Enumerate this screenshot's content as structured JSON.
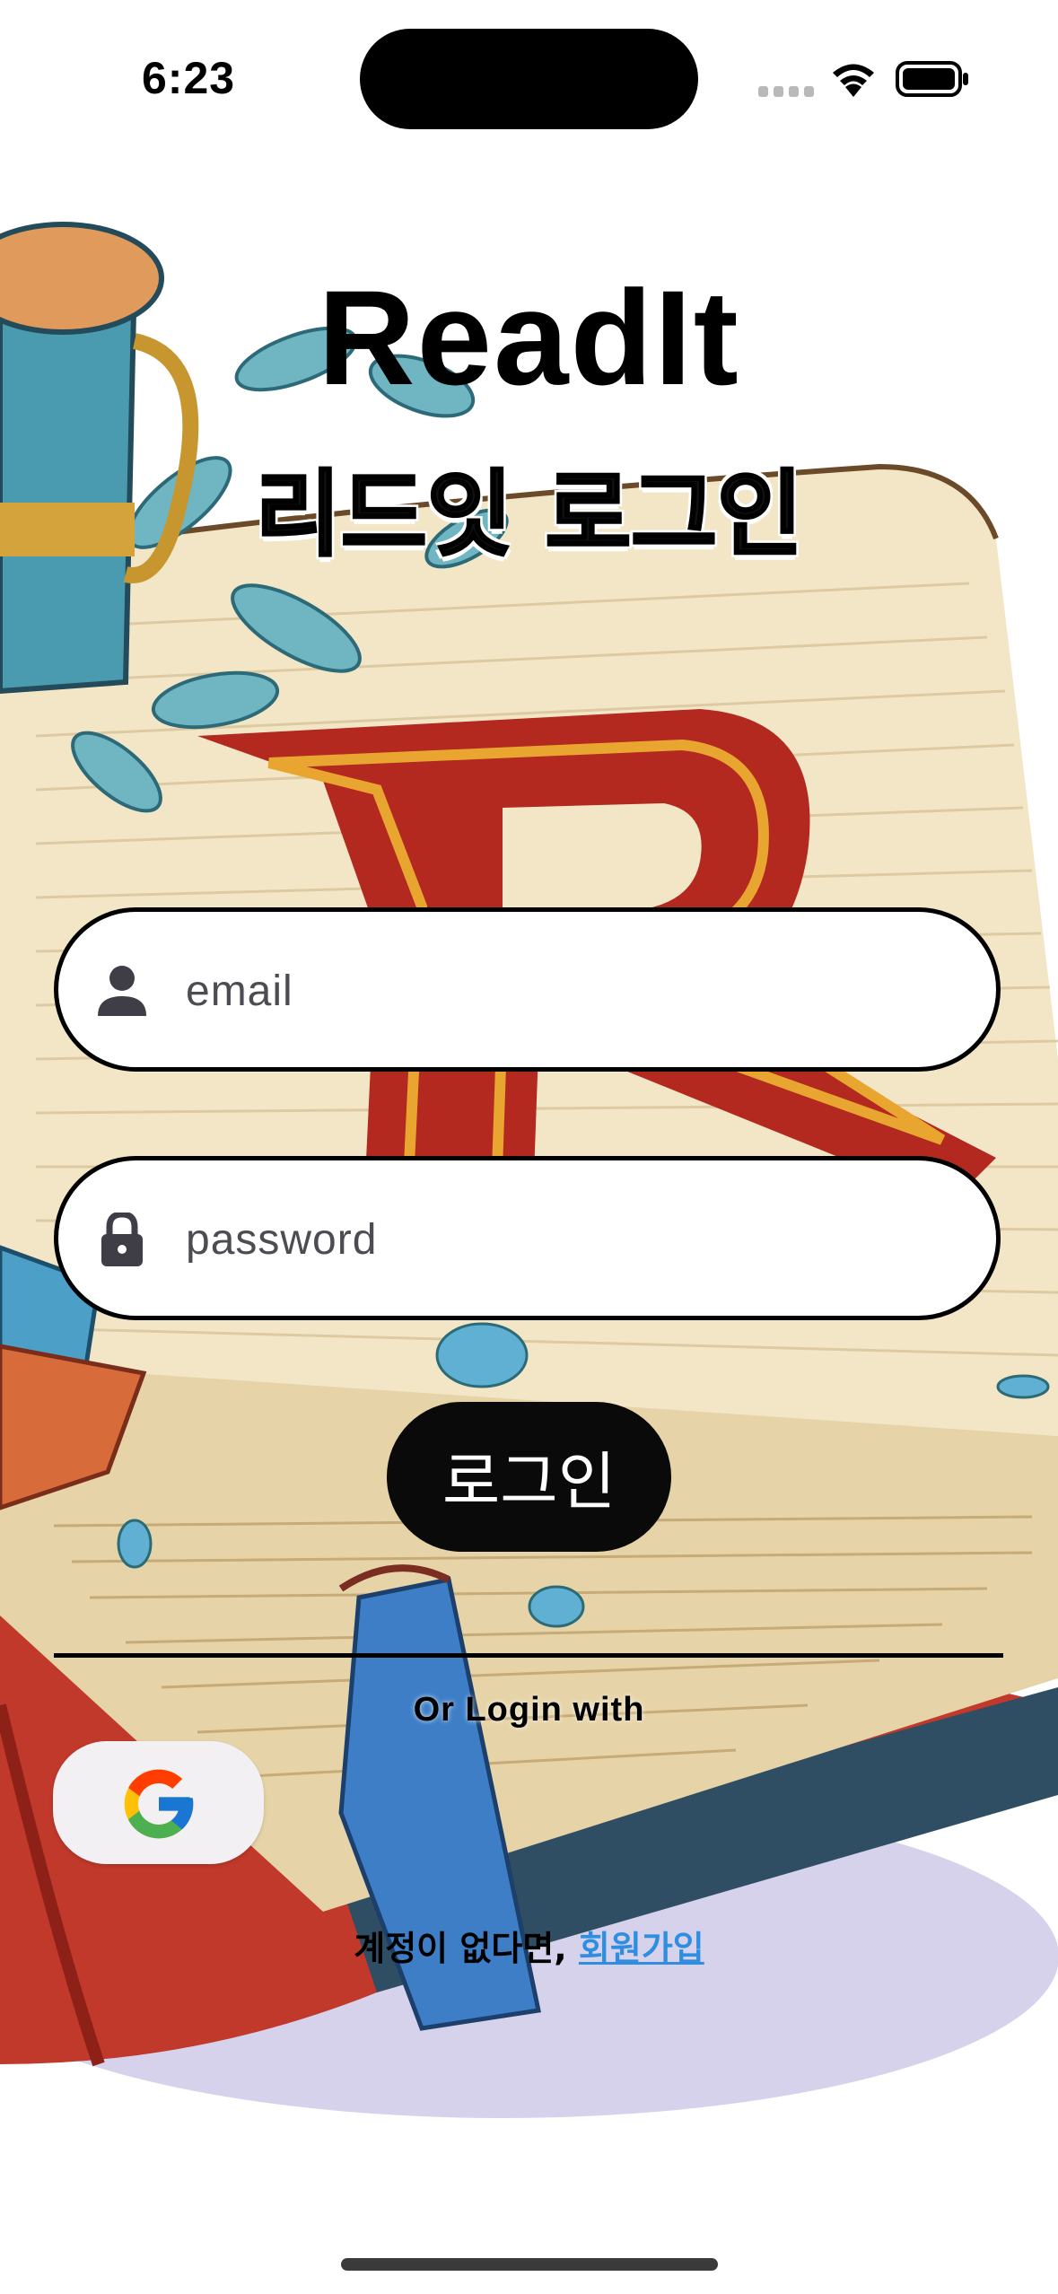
{
  "status_bar": {
    "time": "6:23"
  },
  "header": {
    "title": "ReadIt",
    "subtitle": "리드잇 로그인"
  },
  "form": {
    "email_placeholder": "email",
    "password_placeholder": "password",
    "login_label": "로그인"
  },
  "social": {
    "or_text": "Or Login with",
    "google_icon": "google-logo-icon"
  },
  "footer": {
    "prompt": "계정이 없다면, ",
    "signup_label": "회원가입"
  },
  "icons": {
    "email": "person-icon",
    "password": "lock-icon"
  },
  "colors": {
    "link": "#2f8ee0",
    "button": "#0a0a0a",
    "field_border": "#000000"
  }
}
